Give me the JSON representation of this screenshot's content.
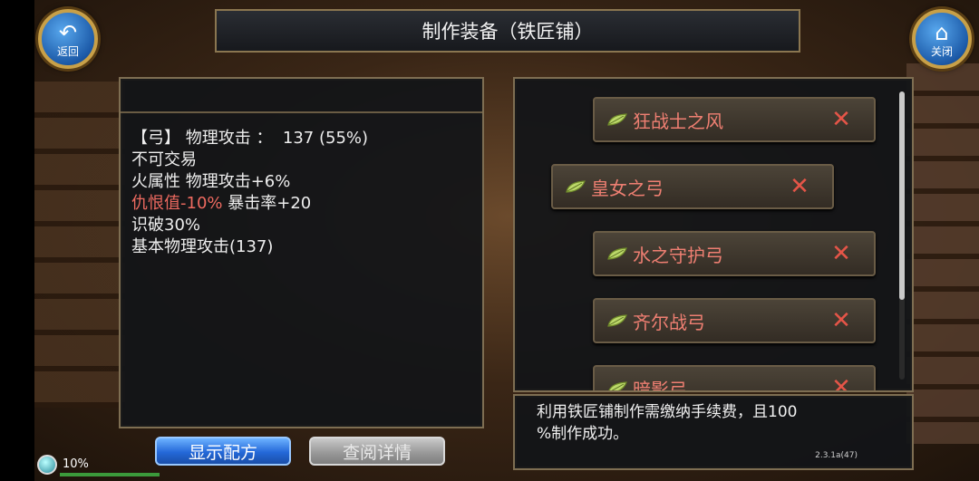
{
  "header": {
    "title": "制作装备（铁匠铺）",
    "back_label": "返回",
    "close_label": "关闭"
  },
  "item": {
    "lines": [
      {
        "text": "【弓】 物理攻击 ：  137 (55%)"
      },
      {
        "text": "不可交易"
      },
      {
        "text": "火属性 物理攻击+6%"
      },
      {
        "red": "仇恨值-10%",
        "text": " 暴击率+20"
      },
      {
        "text": "识破30%"
      },
      {
        "text": "基本物理攻击(137)"
      }
    ]
  },
  "recipes": [
    {
      "name": "狂战士之风",
      "remove": "✕"
    },
    {
      "name": "皇女之弓",
      "remove": "✕"
    },
    {
      "name": "水之守护弓",
      "remove": "✕"
    },
    {
      "name": "齐尔战弓",
      "remove": "✕"
    },
    {
      "name": "暗影弓",
      "remove": "✕"
    }
  ],
  "note": {
    "line1": "利用铁匠铺制作需缴纳手续费，且100",
    "line2": "%制作成功。"
  },
  "buttons": {
    "show_recipe": "显示配方",
    "view_details": "查阅详情"
  },
  "status": {
    "percent_text": "10%",
    "version": "2.3.1a(47)"
  },
  "colors": {
    "recipe_text": "#ef7f72",
    "red_stat": "#ee6a60",
    "primary_button": "#2468d8"
  }
}
